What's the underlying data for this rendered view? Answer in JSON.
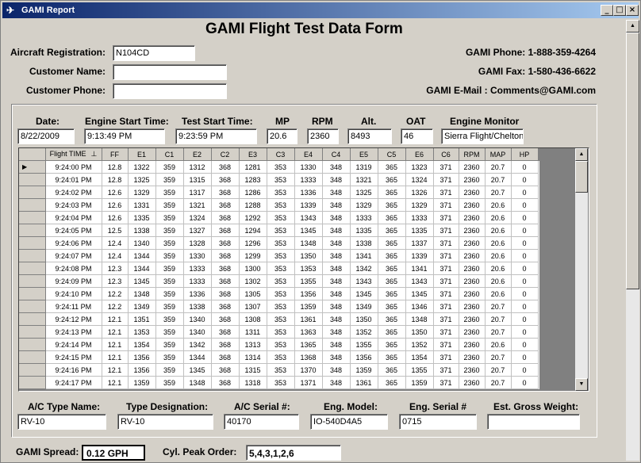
{
  "window": {
    "title": "GAMI Report"
  },
  "form_title": "GAMI Flight Test Data Form",
  "customer": {
    "registration_label": "Aircraft Registration:",
    "registration_value": "N104CD",
    "name_label": "Customer Name:",
    "name_value": "",
    "phone_label": "Customer Phone:",
    "phone_value": ""
  },
  "contact": {
    "phone": "GAMI Phone: 1-888-359-4264",
    "fax": "GAMI Fax: 1-580-436-6622",
    "email": "GAMI E-Mail : Comments@GAMI.com"
  },
  "header_fields": [
    {
      "label": "Date:",
      "value": "8/22/2009"
    },
    {
      "label": "Engine Start Time:",
      "value": "9:13:49 PM"
    },
    {
      "label": "Test Start Time:",
      "value": "9:23:59 PM"
    },
    {
      "label": "MP",
      "value": "20.6"
    },
    {
      "label": "RPM",
      "value": "2360"
    },
    {
      "label": "Alt.",
      "value": "8493"
    },
    {
      "label": "OAT",
      "value": "46"
    },
    {
      "label": "Engine Monitor",
      "value": "Sierra Flight/Chelton"
    }
  ],
  "table": {
    "columns": [
      "Flight TIME",
      "FF",
      "E1",
      "C1",
      "E2",
      "C2",
      "E3",
      "C3",
      "E4",
      "C4",
      "E5",
      "C5",
      "E6",
      "C6",
      "RPM",
      "MAP",
      "HP"
    ],
    "sort_indicator": "⊥",
    "rows": [
      [
        "9:24:00 PM",
        "12.8",
        "1322",
        "359",
        "1312",
        "368",
        "1281",
        "353",
        "1330",
        "348",
        "1319",
        "365",
        "1323",
        "371",
        "2360",
        "20.7",
        "0"
      ],
      [
        "9:24:01 PM",
        "12.8",
        "1325",
        "359",
        "1315",
        "368",
        "1283",
        "353",
        "1333",
        "348",
        "1321",
        "365",
        "1324",
        "371",
        "2360",
        "20.7",
        "0"
      ],
      [
        "9:24:02 PM",
        "12.6",
        "1329",
        "359",
        "1317",
        "368",
        "1286",
        "353",
        "1336",
        "348",
        "1325",
        "365",
        "1326",
        "371",
        "2360",
        "20.7",
        "0"
      ],
      [
        "9:24:03 PM",
        "12.6",
        "1331",
        "359",
        "1321",
        "368",
        "1288",
        "353",
        "1339",
        "348",
        "1329",
        "365",
        "1329",
        "371",
        "2360",
        "20.6",
        "0"
      ],
      [
        "9:24:04 PM",
        "12.6",
        "1335",
        "359",
        "1324",
        "368",
        "1292",
        "353",
        "1343",
        "348",
        "1333",
        "365",
        "1333",
        "371",
        "2360",
        "20.6",
        "0"
      ],
      [
        "9:24:05 PM",
        "12.5",
        "1338",
        "359",
        "1327",
        "368",
        "1294",
        "353",
        "1345",
        "348",
        "1335",
        "365",
        "1335",
        "371",
        "2360",
        "20.6",
        "0"
      ],
      [
        "9:24:06 PM",
        "12.4",
        "1340",
        "359",
        "1328",
        "368",
        "1296",
        "353",
        "1348",
        "348",
        "1338",
        "365",
        "1337",
        "371",
        "2360",
        "20.6",
        "0"
      ],
      [
        "9:24:07 PM",
        "12.4",
        "1344",
        "359",
        "1330",
        "368",
        "1299",
        "353",
        "1350",
        "348",
        "1341",
        "365",
        "1339",
        "371",
        "2360",
        "20.6",
        "0"
      ],
      [
        "9:24:08 PM",
        "12.3",
        "1344",
        "359",
        "1333",
        "368",
        "1300",
        "353",
        "1353",
        "348",
        "1342",
        "365",
        "1341",
        "371",
        "2360",
        "20.6",
        "0"
      ],
      [
        "9:24:09 PM",
        "12.3",
        "1345",
        "359",
        "1333",
        "368",
        "1302",
        "353",
        "1355",
        "348",
        "1343",
        "365",
        "1343",
        "371",
        "2360",
        "20.6",
        "0"
      ],
      [
        "9:24:10 PM",
        "12.2",
        "1348",
        "359",
        "1336",
        "368",
        "1305",
        "353",
        "1356",
        "348",
        "1345",
        "365",
        "1345",
        "371",
        "2360",
        "20.6",
        "0"
      ],
      [
        "9:24:11 PM",
        "12.2",
        "1349",
        "359",
        "1338",
        "368",
        "1307",
        "353",
        "1359",
        "348",
        "1349",
        "365",
        "1346",
        "371",
        "2360",
        "20.7",
        "0"
      ],
      [
        "9:24:12 PM",
        "12.1",
        "1351",
        "359",
        "1340",
        "368",
        "1308",
        "353",
        "1361",
        "348",
        "1350",
        "365",
        "1348",
        "371",
        "2360",
        "20.7",
        "0"
      ],
      [
        "9:24:13 PM",
        "12.1",
        "1353",
        "359",
        "1340",
        "368",
        "1311",
        "353",
        "1363",
        "348",
        "1352",
        "365",
        "1350",
        "371",
        "2360",
        "20.7",
        "0"
      ],
      [
        "9:24:14 PM",
        "12.1",
        "1354",
        "359",
        "1342",
        "368",
        "1313",
        "353",
        "1365",
        "348",
        "1355",
        "365",
        "1352",
        "371",
        "2360",
        "20.6",
        "0"
      ],
      [
        "9:24:15 PM",
        "12.1",
        "1356",
        "359",
        "1344",
        "368",
        "1314",
        "353",
        "1368",
        "348",
        "1356",
        "365",
        "1354",
        "371",
        "2360",
        "20.7",
        "0"
      ],
      [
        "9:24:16 PM",
        "12.1",
        "1356",
        "359",
        "1345",
        "368",
        "1315",
        "353",
        "1370",
        "348",
        "1359",
        "365",
        "1355",
        "371",
        "2360",
        "20.7",
        "0"
      ],
      [
        "9:24:17 PM",
        "12.1",
        "1359",
        "359",
        "1348",
        "368",
        "1318",
        "353",
        "1371",
        "348",
        "1361",
        "365",
        "1359",
        "371",
        "2360",
        "20.7",
        "0"
      ]
    ]
  },
  "aircraft": [
    {
      "label": "A/C Type Name:",
      "value": "RV-10"
    },
    {
      "label": "Type Designation:",
      "value": "RV-10"
    },
    {
      "label": "A/C Serial #:",
      "value": "40170"
    },
    {
      "label": "Eng. Model:",
      "value": "IO-540D4A5"
    },
    {
      "label": "Eng. Serial #",
      "value": "0715"
    },
    {
      "label": "Est. Gross Weight:",
      "value": ""
    }
  ],
  "spread": {
    "label": "GAMI Spread:",
    "value": "0.12 GPH"
  },
  "peak_order": {
    "label": "Cyl. Peak Order:",
    "value": "5,4,3,1,2,6"
  }
}
